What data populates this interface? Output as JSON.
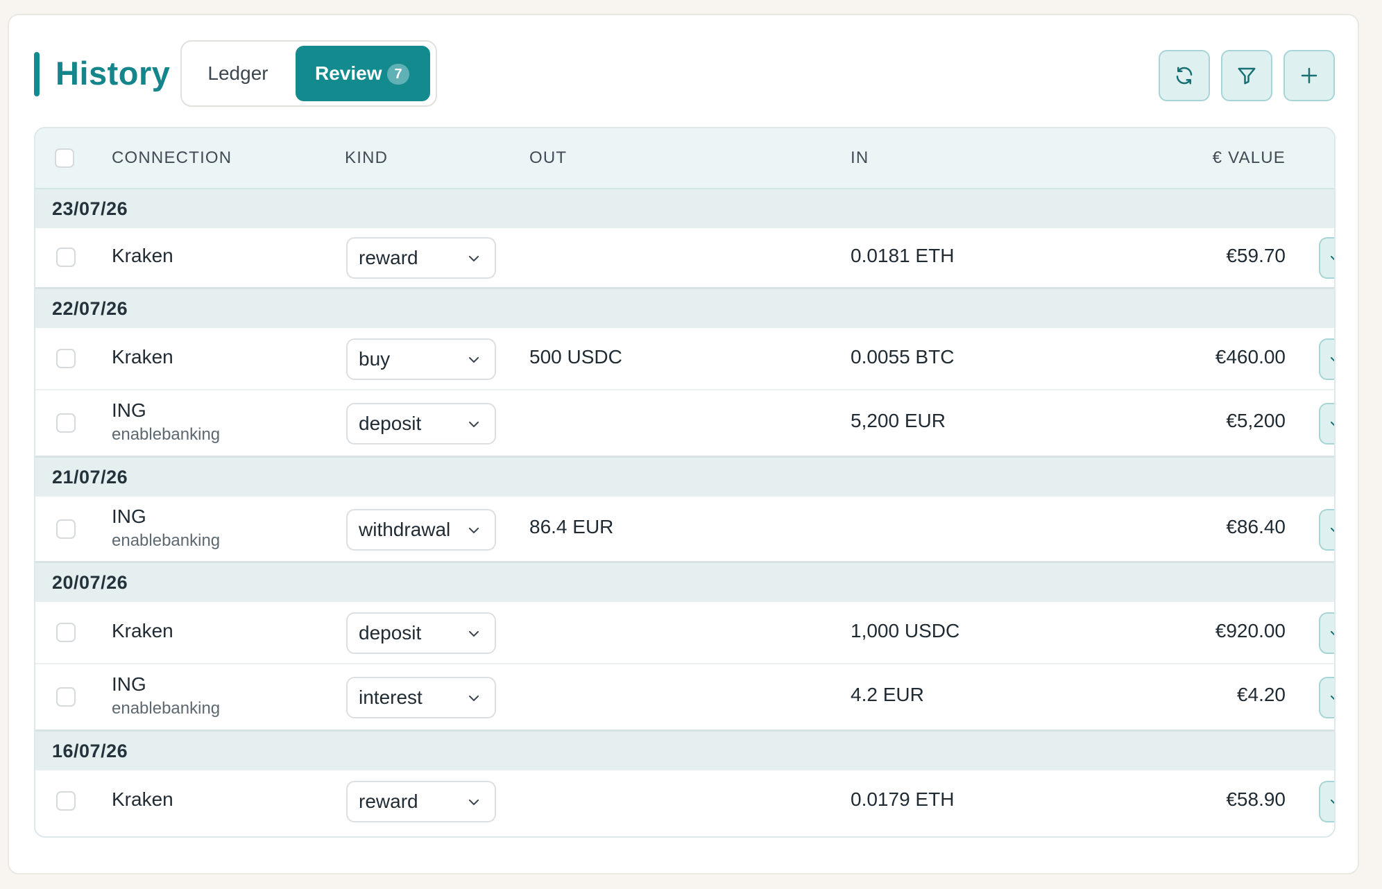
{
  "header": {
    "title": "History",
    "tabs": [
      {
        "label": "Ledger",
        "active": false
      },
      {
        "label": "Review",
        "active": true,
        "badge": "7"
      }
    ],
    "actions": [
      {
        "icon": "refresh-icon"
      },
      {
        "icon": "filter-icon"
      },
      {
        "icon": "plus-icon"
      }
    ]
  },
  "table": {
    "columns": {
      "connection": "CONNECTION",
      "kind": "KIND",
      "out": "OUT",
      "in": "IN",
      "value": "€ VALUE"
    },
    "groups": [
      {
        "date": "23/07/26",
        "rows": [
          {
            "connection": "Kraken",
            "sub": "",
            "kind": "reward",
            "out": "",
            "in": "0.0181 ETH",
            "value": "€59.70"
          }
        ]
      },
      {
        "date": "22/07/26",
        "rows": [
          {
            "connection": "Kraken",
            "sub": "",
            "kind": "buy",
            "out": "500 USDC",
            "in": "0.0055 BTC",
            "value": "€460.00"
          },
          {
            "connection": "ING",
            "sub": "enablebanking",
            "kind": "deposit",
            "out": "",
            "in": "5,200 EUR",
            "value": "€5,200"
          }
        ]
      },
      {
        "date": "21/07/26",
        "rows": [
          {
            "connection": "ING",
            "sub": "enablebanking",
            "kind": "withdrawal",
            "out": "86.4 EUR",
            "in": "",
            "value": "€86.40"
          }
        ]
      },
      {
        "date": "20/07/26",
        "rows": [
          {
            "connection": "Kraken",
            "sub": "",
            "kind": "deposit",
            "out": "",
            "in": "1,000 USDC",
            "value": "€920.00"
          },
          {
            "connection": "ING",
            "sub": "enablebanking",
            "kind": "interest",
            "out": "",
            "in": "4.2 EUR",
            "value": "€4.20"
          }
        ]
      },
      {
        "date": "16/07/26",
        "rows": [
          {
            "connection": "Kraken",
            "sub": "",
            "kind": "reward",
            "out": "",
            "in": "0.0179 ETH",
            "value": "€58.90"
          }
        ]
      }
    ]
  },
  "colors": {
    "accent": "#128a8e",
    "accent_soft": "#dff0f0",
    "header_bg": "#ecf5f6",
    "group_bg": "#e5efef"
  }
}
